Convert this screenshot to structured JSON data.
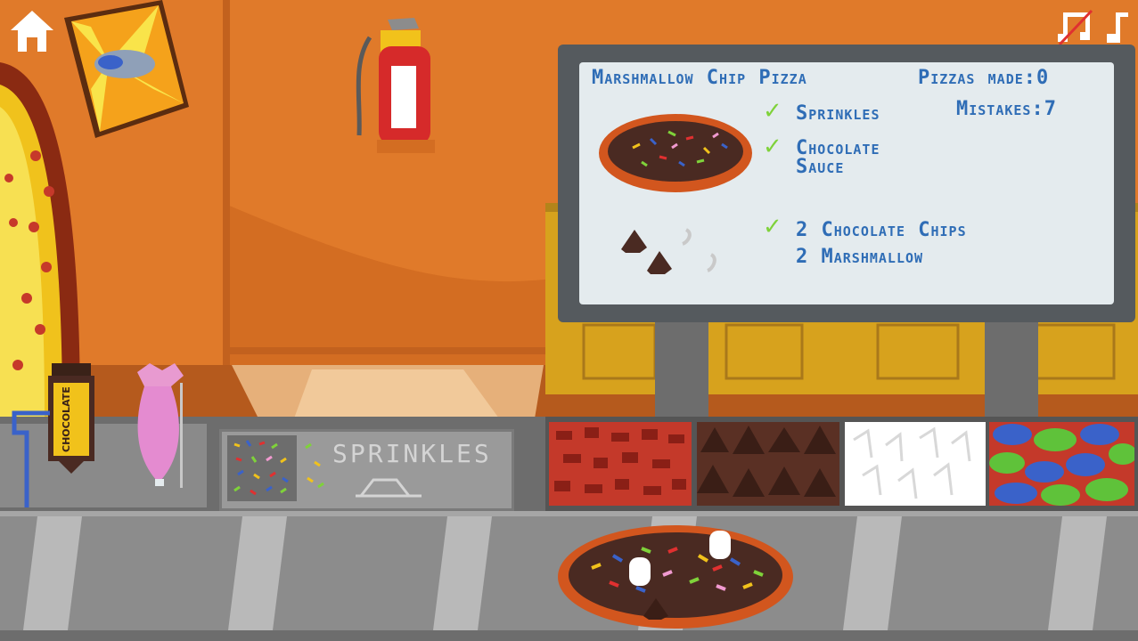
{
  "header": {
    "home_icon": "home-icon",
    "music_icon": "music-muted-icon",
    "note_icon": "music-note-icon"
  },
  "order_board": {
    "pizza_name": "Marshmallow Chip Pizza",
    "pizzas_made_label": "Pizzas made:",
    "pizzas_made_value": "0",
    "mistakes_label": "Mistakes:",
    "mistakes_value": "7",
    "items": [
      {
        "label": "Sprinkles",
        "checked": true
      },
      {
        "label": "Chocolate",
        "label2": "Sauce",
        "checked": true
      },
      {
        "label": "2 Chocolate Chips",
        "checked": true
      },
      {
        "label": "2 Marshmallow",
        "checked": false
      }
    ]
  },
  "counter": {
    "chocolate_bottle_label": "CHOCOLATE",
    "sprinkles_label": "SPRINKLES",
    "bins": [
      "pepperoni",
      "chocolate-chips",
      "marshmallows",
      "jelly-beans"
    ]
  },
  "colors": {
    "wall": "#e07a2a",
    "board_bg": "#e4ebee",
    "board_text": "#2f6db6",
    "check": "#7fd23a",
    "belt": "#8a8a8a"
  }
}
